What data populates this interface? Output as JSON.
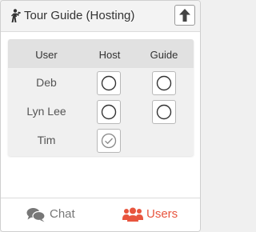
{
  "header": {
    "title": "Tour Guide (Hosting)",
    "title_icon": "tour-guide-icon",
    "up_button_icon": "arrow-up-icon"
  },
  "table": {
    "columns": [
      "User",
      "Host",
      "Guide"
    ],
    "rows": [
      {
        "user": "Deb",
        "host": "unchecked",
        "guide": "unchecked"
      },
      {
        "user": "Lyn Lee",
        "host": "unchecked",
        "guide": "unchecked"
      },
      {
        "user": "Tim",
        "host": "checked",
        "guide": null
      }
    ]
  },
  "footer": {
    "tabs": [
      {
        "label": "Chat",
        "icon": "chat-icon",
        "active": false
      },
      {
        "label": "Users",
        "icon": "users-icon",
        "active": true
      }
    ]
  },
  "colors": {
    "accent": "#e8553e",
    "header_bg": "#f3f3f3",
    "table_header_bg": "#e1e1e1",
    "table_body_bg": "#f0f0f0"
  }
}
